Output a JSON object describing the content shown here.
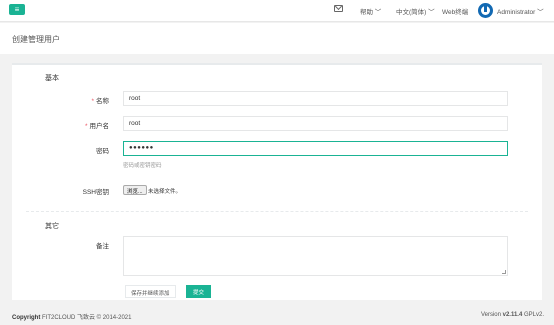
{
  "header": {
    "menu_icon": "bars-icon",
    "mail_icon": "envelope-icon",
    "help": "帮助 ﹀",
    "language": "中文(简体) ﹀",
    "web_terminal": "Web终端",
    "user": "Administrator ﹀"
  },
  "page": {
    "title": "创建管理用户"
  },
  "form": {
    "basic_title": "基本",
    "name_label": "名称",
    "name_value": "root",
    "username_label": "用户名",
    "username_value": "root",
    "password_label": "密码",
    "password_value": "●●●●●●",
    "password_help": "密码或密钥密码",
    "ssh_key_label": "SSH密钥",
    "file_button": "浏览...",
    "file_none": "未选择文件。",
    "other_title": "其它",
    "comment_label": "备注",
    "save_continue": "保存并继续添加",
    "submit": "提交"
  },
  "footer": {
    "copyright_bold": "Copyright",
    "copyright_text": " FIT2CLOUD 飞致云 © 2014-2021",
    "version_prefix": "Version ",
    "version_number": "v2.11.4",
    "license": " GPLv2."
  }
}
